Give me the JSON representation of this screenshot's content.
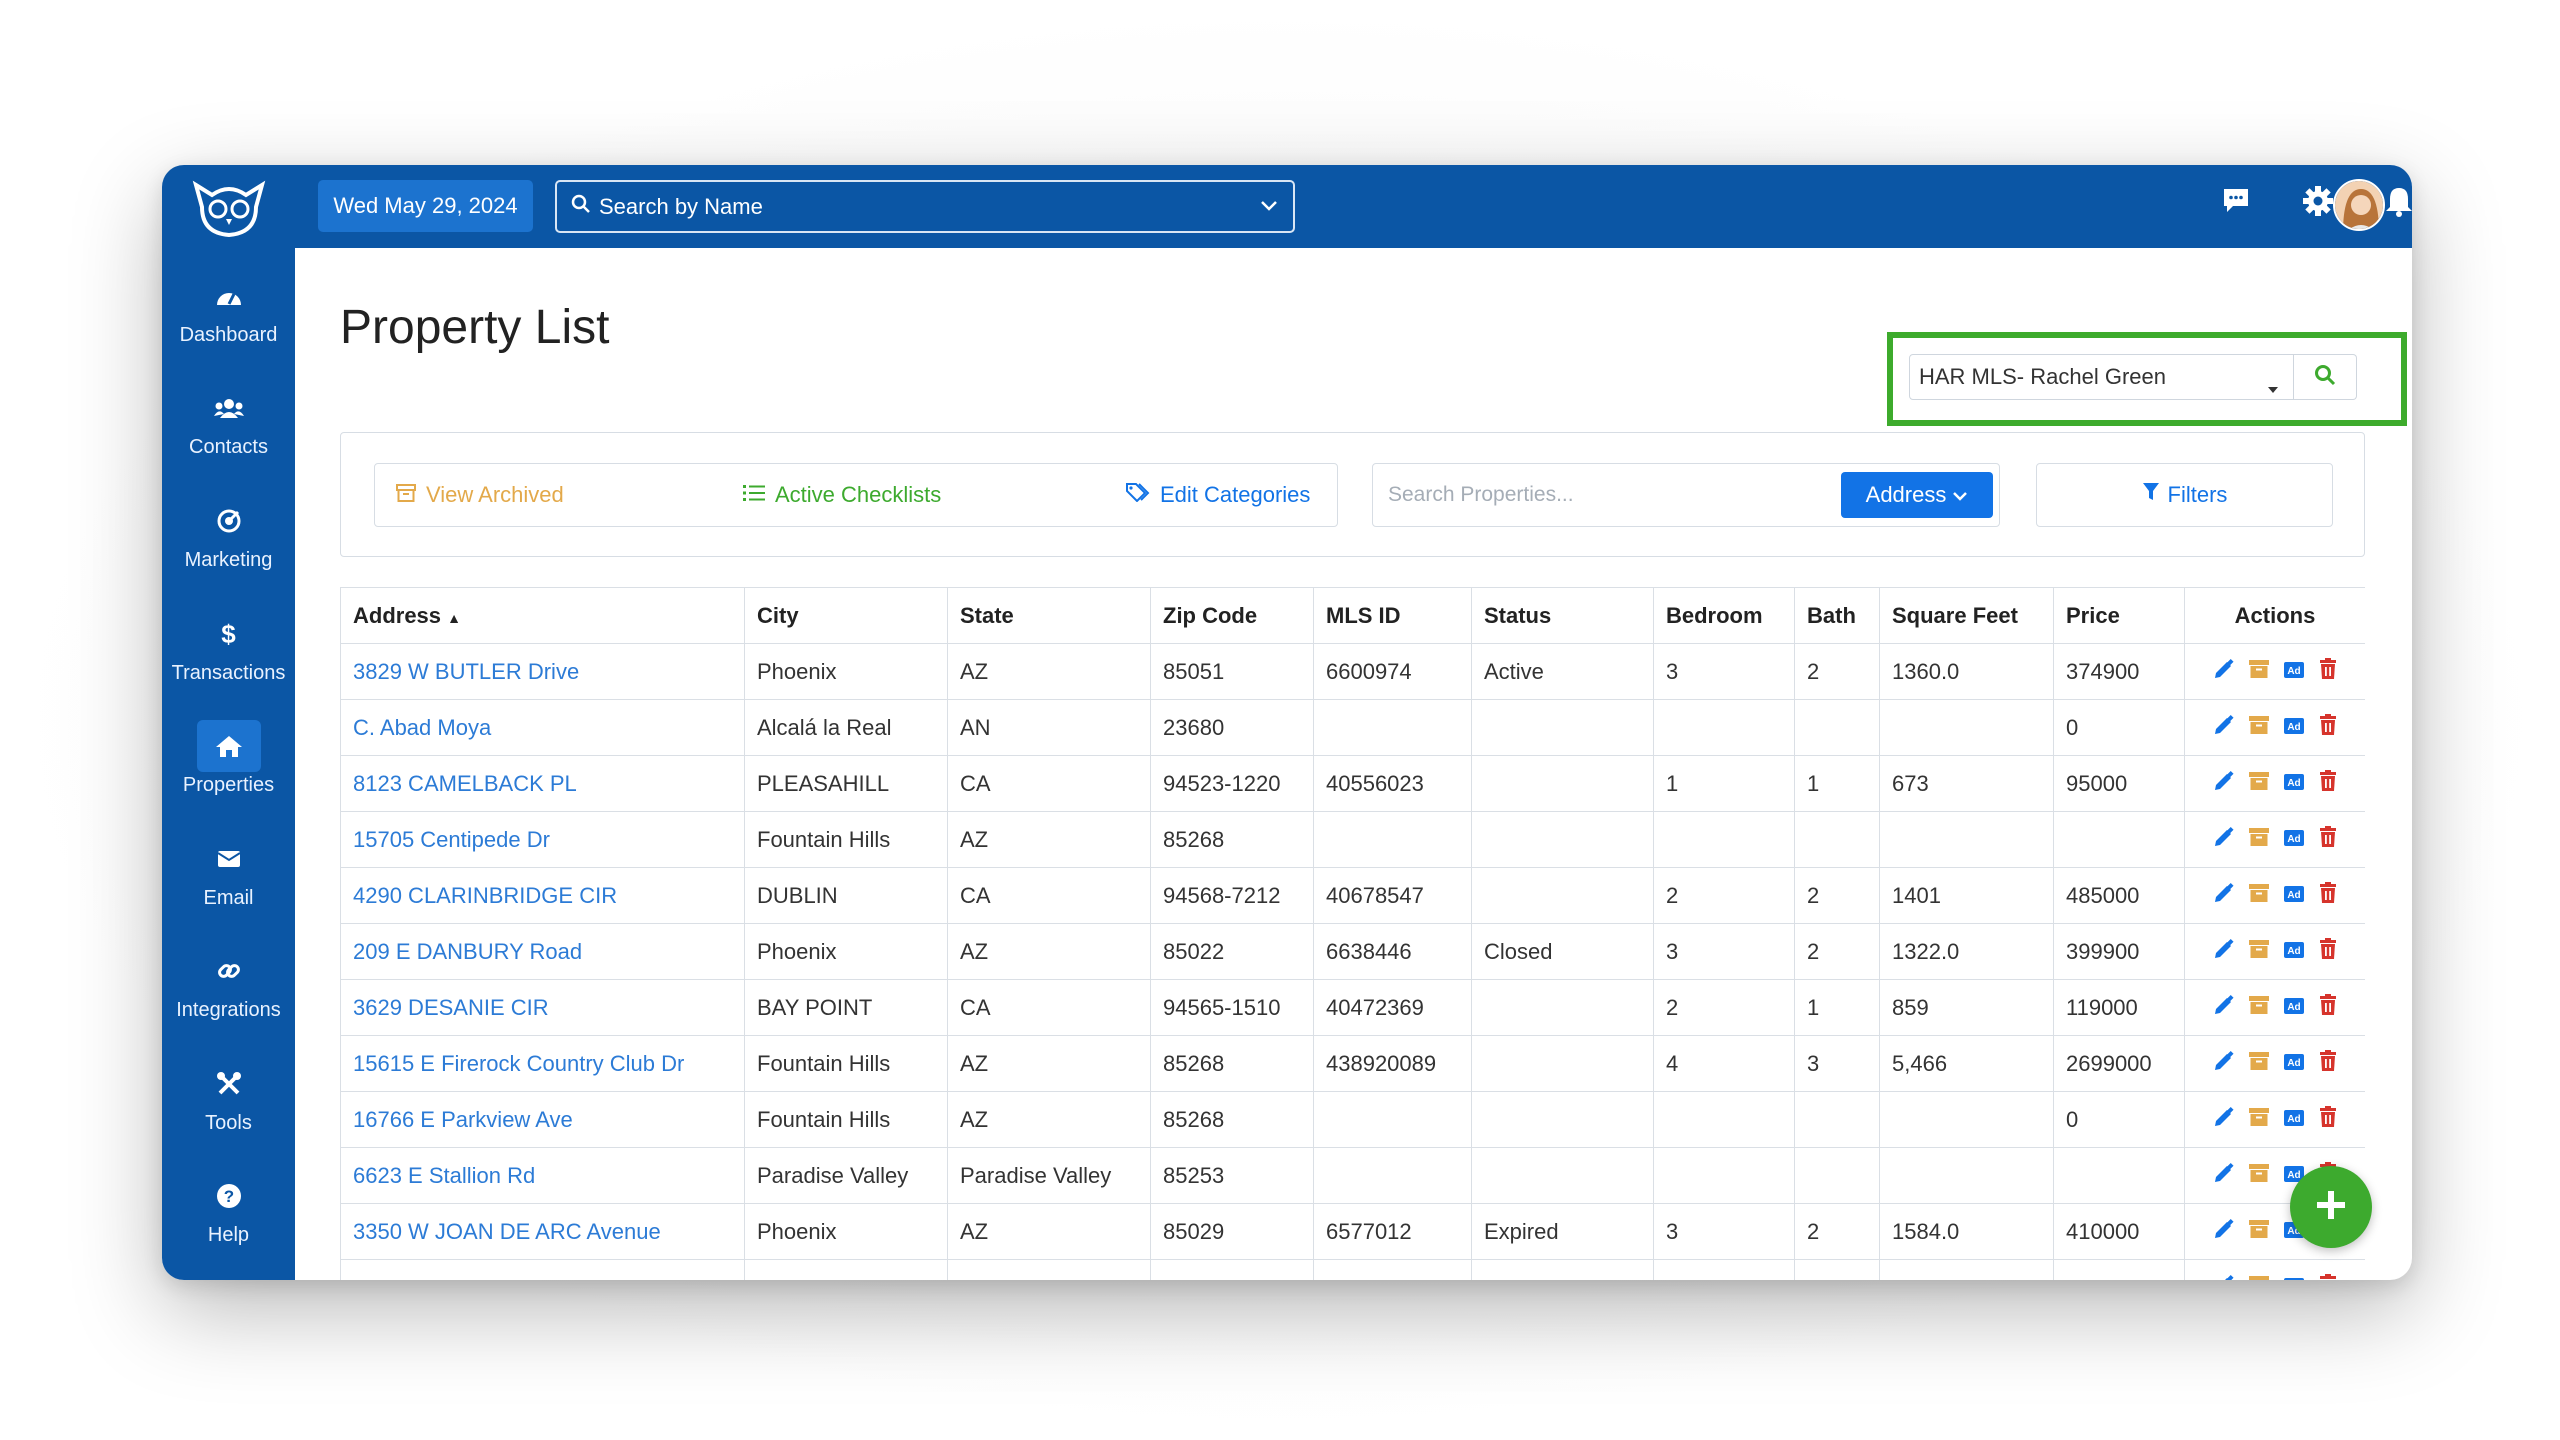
{
  "topbar": {
    "date": "Wed May 29, 2024",
    "search_placeholder": "Search by Name"
  },
  "sidebar": {
    "items": [
      {
        "label": "Dashboard",
        "icon": "dashboard-gauge-icon"
      },
      {
        "label": "Contacts",
        "icon": "users-icon"
      },
      {
        "label": "Marketing",
        "icon": "bullseye-icon"
      },
      {
        "label": "Transactions",
        "icon": "dollar-icon"
      },
      {
        "label": "Properties",
        "icon": "home-icon",
        "active": true
      },
      {
        "label": "Email",
        "icon": "envelope-icon"
      },
      {
        "label": "Integrations",
        "icon": "link-icon"
      },
      {
        "label": "Tools",
        "icon": "wrench-icon"
      },
      {
        "label": "Help",
        "icon": "question-icon"
      }
    ]
  },
  "page": {
    "title": "Property List",
    "mls_select": "HAR MLS- Rachel Green"
  },
  "toolbar": {
    "view_archived": "View Archived",
    "active_checklists": "Active Checklists",
    "edit_categories": "Edit Categories",
    "search_placeholder": "Search Properties...",
    "address_dropdown": "Address",
    "filters": "Filters"
  },
  "table": {
    "headers": [
      "Address",
      "City",
      "State",
      "Zip Code",
      "MLS ID",
      "Status",
      "Bedroom",
      "Bath",
      "Square Feet",
      "Price",
      "Actions"
    ],
    "rows": [
      [
        "3829 W BUTLER Drive",
        "Phoenix",
        "AZ",
        "85051",
        "6600974",
        "Active",
        "3",
        "2",
        "1360.0",
        "374900"
      ],
      [
        "C. Abad Moya",
        "Alcalá la Real",
        "AN",
        "23680",
        "",
        "",
        "",
        "",
        "",
        "0"
      ],
      [
        "8123 CAMELBACK PL",
        "PLEASAHILL",
        "CA",
        "94523-1220",
        "40556023",
        "",
        "1",
        "1",
        "673",
        "95000"
      ],
      [
        "15705 Centipede Dr",
        "Fountain Hills",
        "AZ",
        "85268",
        "",
        "",
        "",
        "",
        "",
        ""
      ],
      [
        "4290 CLARINBRIDGE CIR",
        "DUBLIN",
        "CA",
        "94568-7212",
        "40678547",
        "",
        "2",
        "2",
        "1401",
        "485000"
      ],
      [
        "209 E DANBURY Road",
        "Phoenix",
        "AZ",
        "85022",
        "6638446",
        "Closed",
        "3",
        "2",
        "1322.0",
        "399900"
      ],
      [
        "3629 DESANIE CIR",
        "BAY POINT",
        "CA",
        "94565-1510",
        "40472369",
        "",
        "2",
        "1",
        "859",
        "119000"
      ],
      [
        "15615 E Firerock Country Club Dr",
        "Fountain Hills",
        "AZ",
        "85268",
        "438920089",
        "",
        "4",
        "3",
        "5,466",
        "2699000"
      ],
      [
        "16766 E Parkview Ave",
        "Fountain Hills",
        "AZ",
        "85268",
        "",
        "",
        "",
        "",
        "",
        "0"
      ],
      [
        "6623 E Stallion Rd",
        "Paradise Valley",
        "Paradise Valley",
        "85253",
        "",
        "",
        "",
        "",
        "",
        ""
      ],
      [
        "3350 W JOAN DE ARC Avenue",
        "Phoenix",
        "AZ",
        "85029",
        "6577012",
        "Expired",
        "3",
        "2",
        "1584.0",
        "410000"
      ],
      [
        "",
        "",
        "",
        "",
        "",
        "",
        "",
        "",
        "",
        ""
      ]
    ]
  },
  "colors": {
    "brand": "#0b56a5",
    "link": "#2c7bd6",
    "edit": "#1273e6",
    "archive": "#e3a94a",
    "delete": "#d6342c",
    "success": "#3daa2e",
    "highlight": "#3dab2c"
  }
}
